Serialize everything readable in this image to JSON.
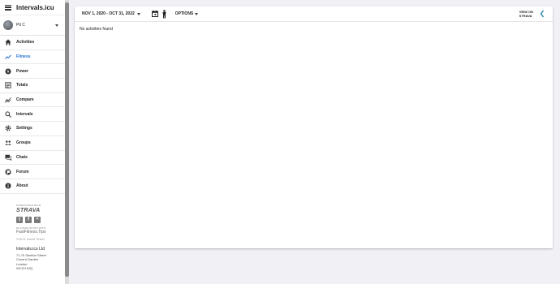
{
  "app": {
    "title": "Intervals.icu"
  },
  "user": {
    "name": "Pit C"
  },
  "nav": [
    {
      "label": "Activities",
      "icon": "home-icon",
      "active": false
    },
    {
      "label": "Fitness",
      "icon": "trend-icon",
      "active": true
    },
    {
      "label": "Power",
      "icon": "power-icon",
      "active": false
    },
    {
      "label": "Totals",
      "icon": "totals-icon",
      "active": false
    },
    {
      "label": "Compare",
      "icon": "compare-icon",
      "active": false
    },
    {
      "label": "Intervals",
      "icon": "search-icon",
      "active": false
    },
    {
      "label": "Settings",
      "icon": "gear-icon",
      "active": false
    },
    {
      "label": "Groups",
      "icon": "groups-icon",
      "active": false
    },
    {
      "label": "Chats",
      "icon": "chat-icon",
      "active": false
    },
    {
      "label": "Forum",
      "icon": "forum-icon",
      "active": false
    },
    {
      "label": "About",
      "icon": "info-icon",
      "active": false
    }
  ],
  "promo": {
    "compatible_with": "COMPATIBLE WITH",
    "strava": "STRAVA",
    "association": "IN ASSOCIATION WITH",
    "fastfitness": "FastFitness.Tips",
    "copyright": "©2021 David Tinker"
  },
  "company": {
    "name": "Intervals.icu Ltd",
    "address": [
      "71-75 Shelton Street",
      "Covent Garden",
      "London",
      "WC2H 9JQ"
    ]
  },
  "toolbar": {
    "date_range": "NOV 1, 2020 - OCT 31, 2022",
    "options_label": "OPTIONS",
    "view_on_strava_line1": "VIEW ON",
    "view_on_strava_line2": "STRAVA"
  },
  "main": {
    "empty_message": "No activities found"
  },
  "colors": {
    "accent": "#1f6fd6",
    "strava": "#fc4c02"
  }
}
